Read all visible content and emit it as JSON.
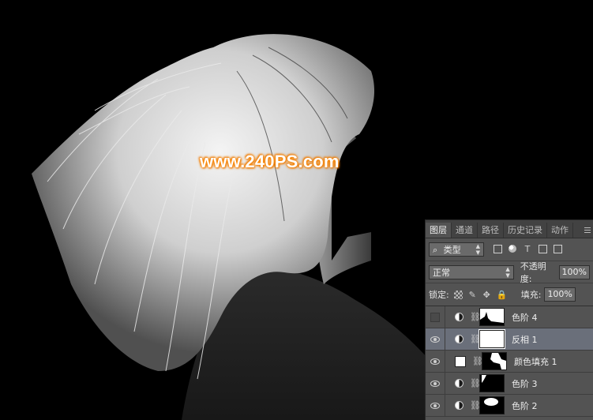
{
  "watermark": "www.240PS.com",
  "layers_panel": {
    "tabs": [
      {
        "label": "图层",
        "active": true
      },
      {
        "label": "通道",
        "active": false
      },
      {
        "label": "路径",
        "active": false
      },
      {
        "label": "历史记录",
        "active": false
      },
      {
        "label": "动作",
        "active": false
      }
    ],
    "filter": {
      "icon": "search-icon",
      "label": "类型"
    },
    "blend_mode": "正常",
    "opacity": {
      "label": "不透明度:",
      "value": "100%"
    },
    "lock": {
      "label": "锁定:"
    },
    "fill": {
      "label": "填充:",
      "value": "100%"
    },
    "layers": [
      {
        "name": "色阶 4",
        "visible": false,
        "kind": "adjustment",
        "selected": false
      },
      {
        "name": "反相 1",
        "visible": true,
        "kind": "adjustment",
        "selected": true
      },
      {
        "name": "颜色填充 1",
        "visible": true,
        "kind": "fill",
        "selected": false
      },
      {
        "name": "色阶 3",
        "visible": true,
        "kind": "adjustment",
        "selected": false
      },
      {
        "name": "色阶 2",
        "visible": true,
        "kind": "adjustment",
        "selected": false
      }
    ]
  }
}
